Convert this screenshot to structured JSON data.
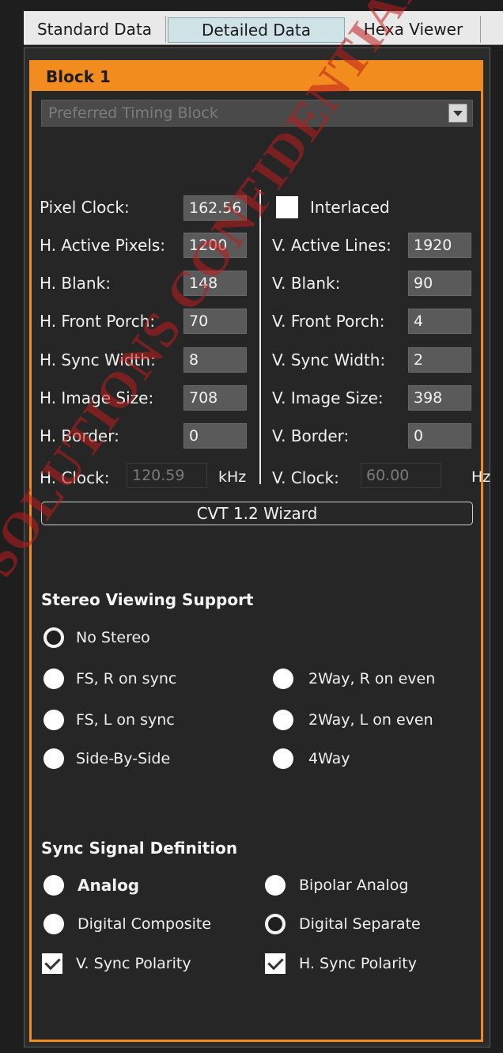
{
  "tabs": [
    "Standard Data",
    "Detailed Data",
    "Hexa Viewer"
  ],
  "block": {
    "title": "Block 1",
    "type": "Preferred Timing Block"
  },
  "timing": {
    "pixel_clock_label": "Pixel Clock:",
    "pixel_clock": "162.56",
    "interlaced_label": "Interlaced",
    "h_active_label": "H. Active Pixels:",
    "h_active": "1200",
    "v_active_label": "V. Active Lines:",
    "v_active": "1920",
    "h_blank_label": "H. Blank:",
    "h_blank": "148",
    "v_blank_label": "V. Blank:",
    "v_blank": "90",
    "h_front_label": "H. Front Porch:",
    "h_front": "70",
    "v_front_label": "V. Front Porch:",
    "v_front": "4",
    "h_sync_label": "H. Sync Width:",
    "h_sync": "8",
    "v_sync_label": "V. Sync Width:",
    "v_sync": "2",
    "h_image_label": "H. Image Size:",
    "h_image": "708",
    "v_image_label": "V. Image Size:",
    "v_image": "398",
    "h_border_label": "H. Border:",
    "h_border": "0",
    "v_border_label": "V. Border:",
    "v_border": "0",
    "h_clock_label": "H. Clock:",
    "h_clock": "120.59",
    "h_clock_unit": "kHz",
    "v_clock_label": "V. Clock:",
    "v_clock": "60.00",
    "v_clock_unit": "Hz"
  },
  "wizard_button": "CVT 1.2 Wizard",
  "stereo": {
    "title": "Stereo Viewing Support",
    "options": [
      "No Stereo",
      "FS, R on sync",
      "2Way, R on even",
      "FS, L on sync",
      "2Way, L on even",
      "Side-By-Side",
      "4Way"
    ],
    "selected": "No Stereo"
  },
  "sync": {
    "title": "Sync Signal Definition",
    "options": [
      "Analog",
      "Bipolar Analog",
      "Digital Composite",
      "Digital Separate"
    ],
    "selected": "Digital Separate",
    "v_polarity_label": "V. Sync Polarity",
    "h_polarity_label": "H. Sync Polarity",
    "v_polarity_checked": true,
    "h_polarity_checked": true
  },
  "watermark": "SOLUTIONS CONFIDENTIAL",
  "colors": {
    "accent": "#f28c1e",
    "background": "#262626",
    "watermark": "#be1e1e"
  }
}
